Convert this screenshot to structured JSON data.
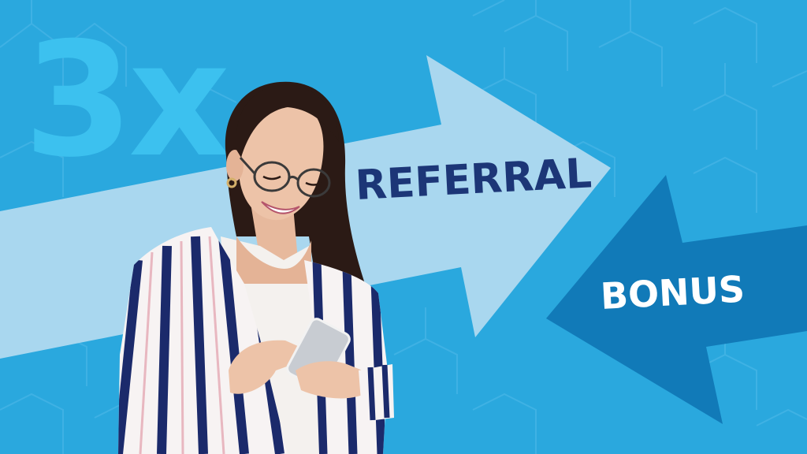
{
  "banner": {
    "multiplier": "3x",
    "referral_label": "REFERRAL",
    "bonus_label": "BONUS"
  },
  "colors": {
    "background": "#2aa8de",
    "pattern_line": "#47b5e6",
    "multiplier_text": "#3cc1ef",
    "referral_arrow": "#a9d7ef",
    "referral_text": "#1c3677",
    "bonus_arrow": "#117ab8",
    "bonus_text": "#ffffff",
    "shirt_stripe": "#1b2a6b"
  },
  "figure": {
    "subject": "smiling woman with glasses in striped shirt holding a smartphone"
  }
}
